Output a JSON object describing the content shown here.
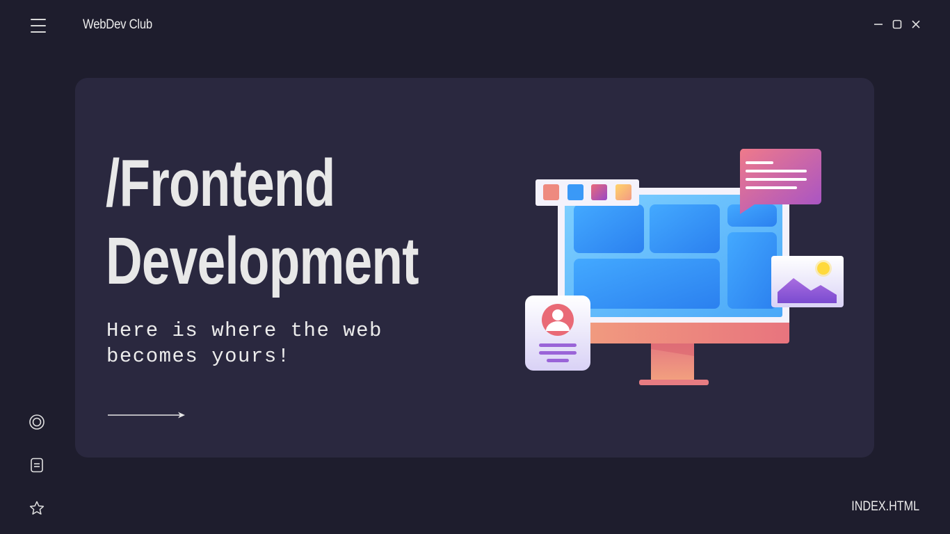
{
  "header": {
    "brand": "WebDev Club",
    "menu_icon": "hamburger-menu-icon",
    "window_controls": [
      "minimize-icon",
      "maximize-icon",
      "close-icon"
    ]
  },
  "hero": {
    "title_line1": "/Frontend",
    "title_line2": "Development",
    "subtitle": "Here is where the web becomes yours!",
    "cta_icon": "long-arrow-right-icon",
    "illustration_icon": "desktop-monitor-illustration"
  },
  "sidebar": {
    "icons": [
      "target-circle-icon",
      "document-icon",
      "star-icon"
    ]
  },
  "footer": {
    "label": "INDEX.HTML"
  },
  "colors": {
    "background": "#1e1d2d",
    "card": "#2a283f",
    "text": "#e8e8e8",
    "screen_blue": "#3d9cf5",
    "monitor_pink": "#e98a8a",
    "bubble_purple": "#b45bc8"
  }
}
